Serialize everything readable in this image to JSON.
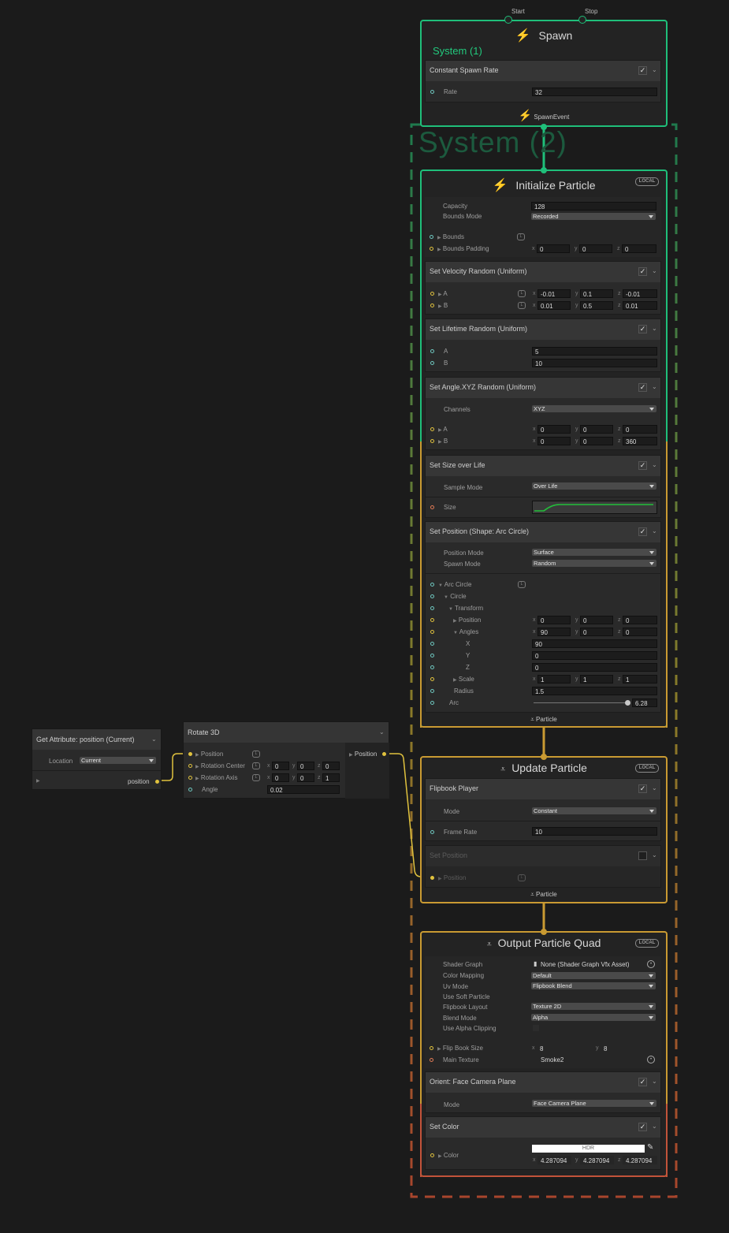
{
  "colors": {
    "spawn": "#1fbf7a",
    "particle": "#c99a32",
    "output": "#c2533a",
    "system2": "#1c5a3e",
    "curve": "#22c03a"
  },
  "spawn": {
    "title": "Spawn",
    "system_label": "System (1)",
    "start": "Start",
    "stop": "Stop",
    "icon": "lightning-icon",
    "block": {
      "title": "Constant Spawn Rate",
      "rate_label": "Rate",
      "rate_value": "32"
    },
    "event_label": "SpawnEvent"
  },
  "system2_title": "System (2)",
  "initialize": {
    "title": "Initialize Particle",
    "local": "LOCAL",
    "capacity_label": "Capacity",
    "capacity_value": "128",
    "bounds_mode_label": "Bounds Mode",
    "bounds_mode_value": "Recorded",
    "bounds_label": "Bounds",
    "bounds_padding_label": "Bounds Padding",
    "bounds_padding": {
      "x": "0",
      "y": "0",
      "z": "0"
    },
    "velocity": {
      "title": "Set Velocity Random (Uniform)",
      "a": "A",
      "b": "B",
      "a_val": {
        "x": "-0.01",
        "y": "0.1",
        "z": "-0.01"
      },
      "b_val": {
        "x": "0.01",
        "y": "0.5",
        "z": "0.01"
      }
    },
    "lifetime": {
      "title": "Set Lifetime Random (Uniform)",
      "a": "A",
      "b": "B",
      "a_val": "5",
      "b_val": "10"
    },
    "angle": {
      "title": "Set Angle.XYZ Random (Uniform)",
      "channels_label": "Channels",
      "channels_value": "XYZ",
      "a": "A",
      "b": "B",
      "a_val": {
        "x": "0",
        "y": "0",
        "z": "0"
      },
      "b_val": {
        "x": "0",
        "y": "0",
        "z": "360"
      }
    },
    "size": {
      "title": "Set Size over Life",
      "sample_mode_label": "Sample Mode",
      "sample_mode_value": "Over Life",
      "size_label": "Size"
    },
    "position": {
      "title": "Set Position (Shape: Arc Circle)",
      "position_mode_label": "Position Mode",
      "position_mode_value": "Surface",
      "spawn_mode_label": "Spawn Mode",
      "spawn_mode_value": "Random",
      "arc_circle": "Arc Circle",
      "circle": "Circle",
      "transform": "Transform",
      "position": "Position",
      "position_val": {
        "x": "0",
        "y": "0",
        "z": "0"
      },
      "angles": "Angles",
      "angles_val": {
        "x": "90",
        "y": "0",
        "z": "0"
      },
      "x": "X",
      "x_val": "90",
      "y": "Y",
      "y_val": "0",
      "z": "Z",
      "z_val": "0",
      "scale": "Scale",
      "scale_val": {
        "x": "1",
        "y": "1",
        "z": "1"
      },
      "radius": "Radius",
      "radius_val": "1.5",
      "arc": "Arc",
      "arc_val": "6.28",
      "arc_fraction": 1.0
    },
    "flow_out": "Particle"
  },
  "update": {
    "title": "Update Particle",
    "local": "LOCAL",
    "flipbook": {
      "title": "Flipbook Player",
      "mode_label": "Mode",
      "mode_value": "Constant",
      "frame_rate_label": "Frame Rate",
      "frame_rate_value": "10"
    },
    "setpos": {
      "title": "Set Position",
      "position_label": "Position"
    },
    "flow_out": "Particle"
  },
  "output": {
    "title": "Output Particle Quad",
    "local": "LOCAL",
    "shader_graph_label": "Shader Graph",
    "shader_graph_value": "None (Shader Graph Vfx Asset)",
    "color_mapping_label": "Color Mapping",
    "color_mapping_value": "Default",
    "uv_mode_label": "Uv Mode",
    "uv_mode_value": "Flipbook Blend",
    "soft_particle_label": "Use Soft Particle",
    "flipbook_layout_label": "Flipbook Layout",
    "flipbook_layout_value": "Texture 2D",
    "blend_mode_label": "Blend Mode",
    "blend_mode_value": "Alpha",
    "alpha_clip_label": "Use Alpha Clipping",
    "flip_book_size_label": "Flip Book Size",
    "flip_book_size": {
      "x": "8",
      "y": "8"
    },
    "main_texture_label": "Main Texture",
    "main_texture_value": "Smoke2",
    "orient": {
      "title": "Orient: Face Camera Plane",
      "mode_label": "Mode",
      "mode_value": "Face Camera Plane"
    },
    "color": {
      "title": "Set Color",
      "color_label": "Color",
      "hdr": "HDR",
      "val": {
        "x": "4.287094",
        "y": "4.287094",
        "z": "4.287094"
      }
    }
  },
  "get_attr": {
    "title": "Get Attribute: position (Current)",
    "location_label": "Location",
    "location_value": "Current",
    "out_label": "position"
  },
  "rotate": {
    "title": "Rotate 3D",
    "position_label": "Position",
    "rotation_center_label": "Rotation Center",
    "rotation_center": {
      "x": "0",
      "y": "0",
      "z": "0"
    },
    "rotation_axis_label": "Rotation Axis",
    "rotation_axis": {
      "x": "0",
      "y": "0",
      "z": "1"
    },
    "angle_label": "Angle",
    "angle_value": "0.02",
    "out_label": "Position"
  },
  "axes": {
    "x": "x",
    "y": "y",
    "z": "z"
  }
}
